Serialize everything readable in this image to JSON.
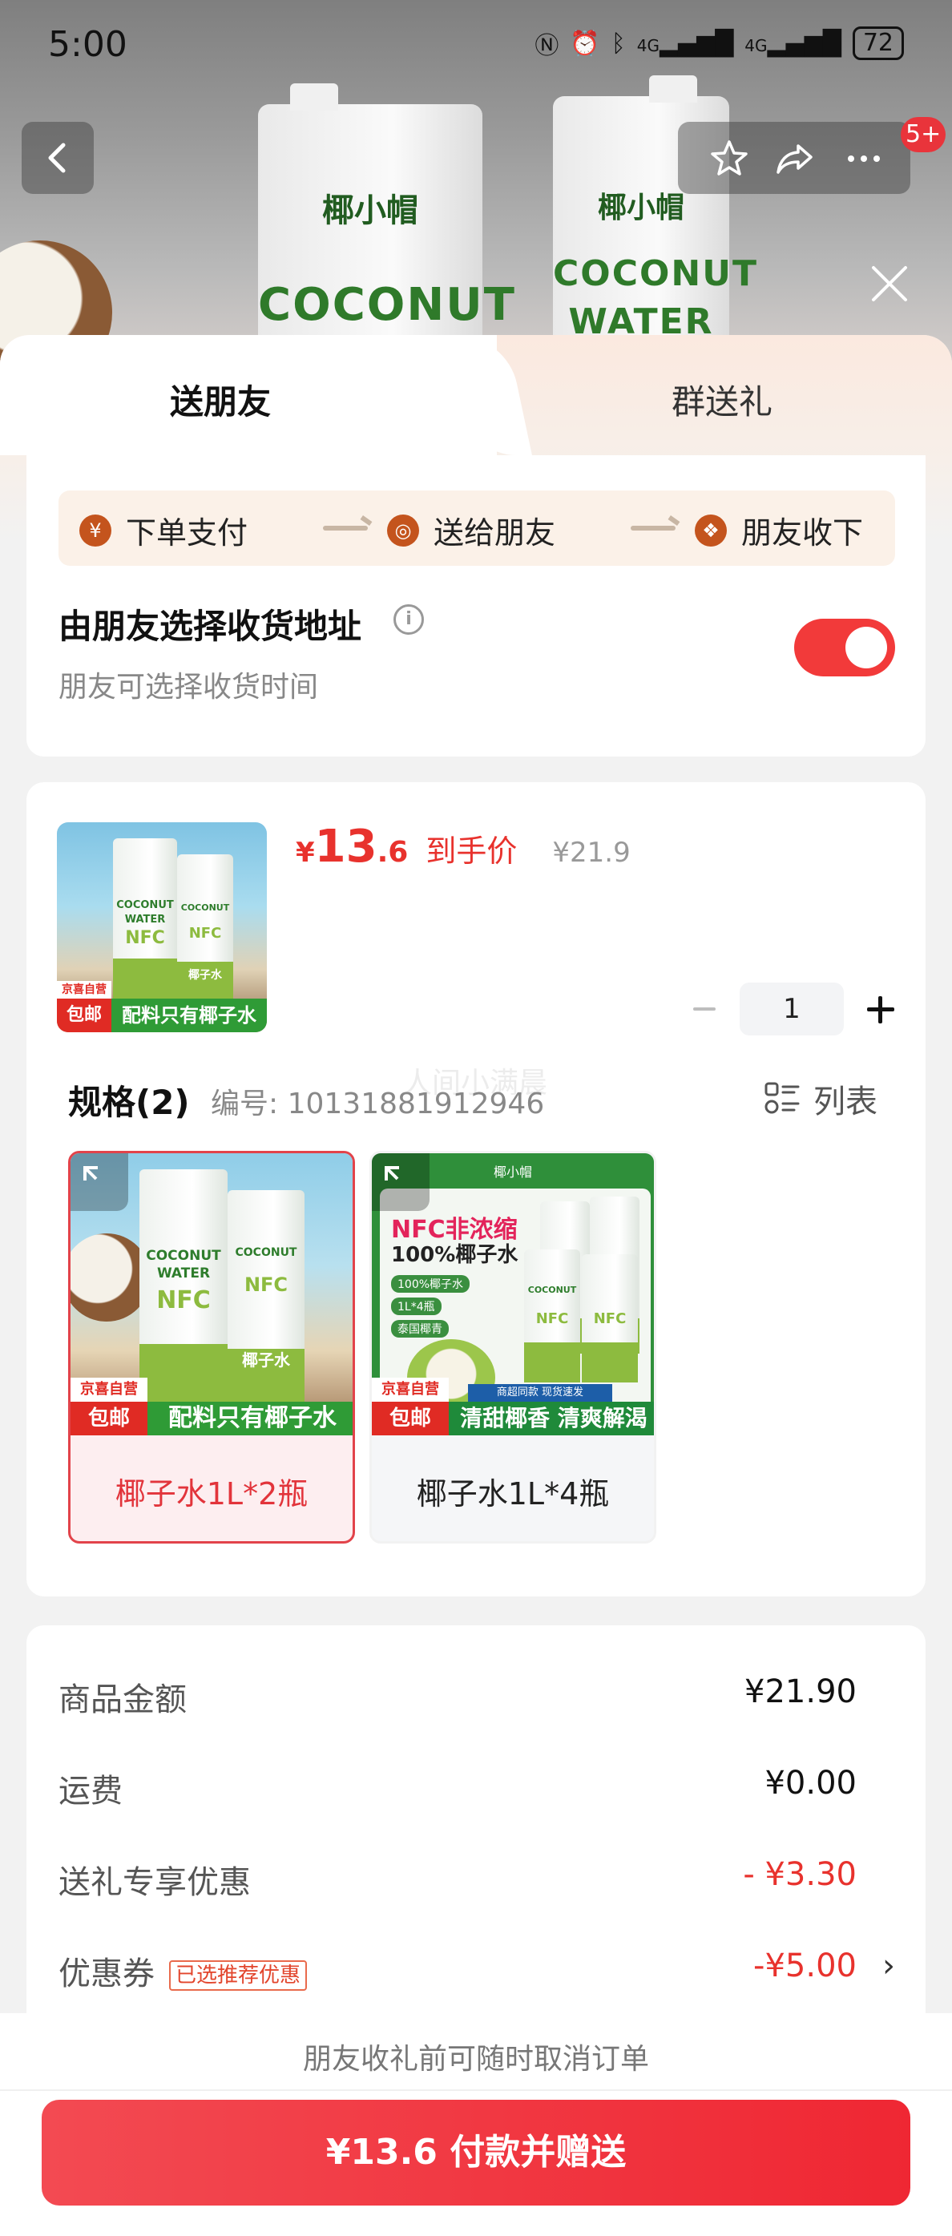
{
  "status_bar": {
    "time": "5:00",
    "battery": "72",
    "signal_1": "4G",
    "signal_2": "4G"
  },
  "header": {
    "badge": "5+"
  },
  "backdrop": {
    "brand": "椰小帽",
    "word1": "COCONUT",
    "word2": "WATER"
  },
  "tabs": [
    {
      "label": "送朋友"
    },
    {
      "label": "群送礼"
    }
  ],
  "steps": [
    {
      "label": "下单支付",
      "icon": "yen-icon"
    },
    {
      "label": "送给朋友",
      "icon": "wechat-icon"
    },
    {
      "label": "朋友收下",
      "icon": "gift-icon"
    }
  ],
  "address": {
    "title": "由朋友选择收货地址",
    "subtitle": "朋友可选择收货时间",
    "toggle_on": true
  },
  "product": {
    "currency": "¥",
    "price_int": "13",
    "price_dec": ".6",
    "price_label": "到手价",
    "original_price": "¥21.9",
    "quantity": "1",
    "thumb_tag_top": "京喜自营",
    "thumb_tag_bottom": "包邮",
    "thumb_banner": "配料只有椰子水",
    "thumb_word1": "COCONUT",
    "thumb_word2": "WATER",
    "thumb_nfc": "NFC",
    "thumb_cn": "椰子水"
  },
  "spec": {
    "title": "规格(2)",
    "code": "编号: 10131881912946",
    "watermark": "人间小满晨",
    "list_label": "列表",
    "options": [
      {
        "label": "椰子水1L*2瓶",
        "selected": true,
        "tag_top": "京喜自营",
        "tag_bottom": "包邮",
        "banner": "配料只有椰子水"
      },
      {
        "label": "椰子水1L*4瓶",
        "selected": false,
        "tag_top": "京喜自营",
        "tag_bottom": "包邮",
        "headline1": "NFC非浓缩",
        "headline2": "100%椰子水",
        "feat1": "100%椰子水",
        "feat2": "1L*4瓶",
        "feat3": "泰国椰青",
        "banner_small": "商超同款 现货速发",
        "banner": "清甜椰香 清爽解渴"
      }
    ]
  },
  "summary": {
    "rows": [
      {
        "label": "商品金额",
        "value": "¥21.90",
        "red": false
      },
      {
        "label": "运费",
        "value": "¥0.00",
        "red": false
      },
      {
        "label": "送礼专享优惠",
        "value": "- ¥3.30",
        "red": true
      },
      {
        "label": "优惠券",
        "value": "-¥5.00",
        "red": true,
        "tag": "已选推荐优惠"
      }
    ]
  },
  "footer": {
    "note": "朋友收礼前可随时取消订单",
    "pay_label": "¥13.6 付款并赠送"
  },
  "colors": {
    "accent": "#e8322d",
    "button": "#ef2733",
    "toggle": "#f23a3a"
  }
}
